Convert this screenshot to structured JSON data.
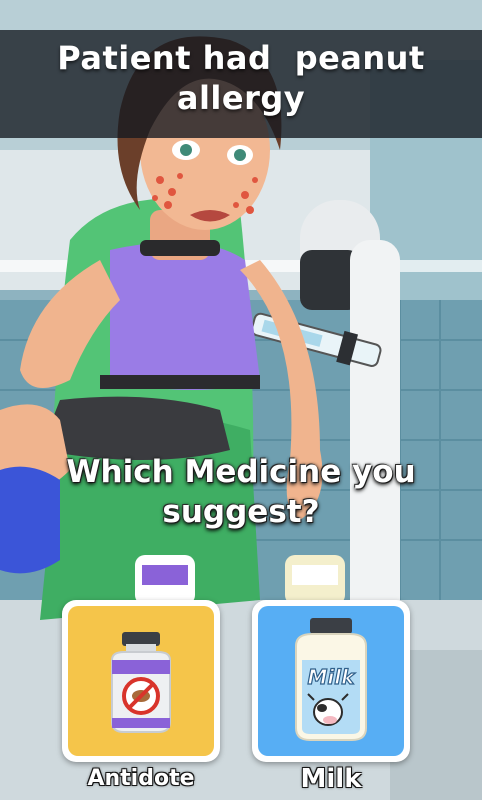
{
  "banner": {
    "line1": "Patient had  peanut",
    "line2": "allergy"
  },
  "question": {
    "line1": "Which Medicine you",
    "line2": "suggest?"
  },
  "options": [
    {
      "label": "Antidote",
      "icon": "antidote-bottle-icon",
      "color": "#f5c54a"
    },
    {
      "label": "Milk",
      "icon": "milk-bottle-icon",
      "color": "#57aef4",
      "bottle_text": "Milk"
    }
  ]
}
